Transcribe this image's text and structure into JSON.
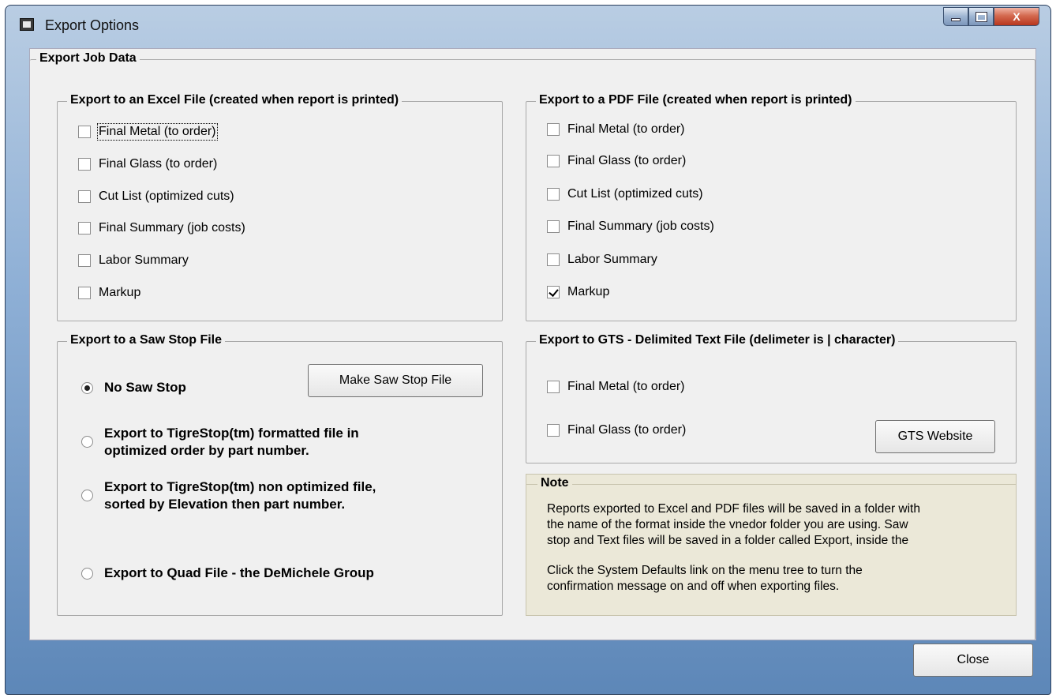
{
  "window": {
    "title": "Export Options",
    "controls": {
      "close_label": "X"
    }
  },
  "main_group": {
    "title": "Export Job Data"
  },
  "excel": {
    "title": "Export to an Excel File (created when report is printed)",
    "items": [
      {
        "label": "Final Metal (to order)",
        "checked": false
      },
      {
        "label": "Final Glass (to order)",
        "checked": false
      },
      {
        "label": "Cut List (optimized cuts)",
        "checked": false
      },
      {
        "label": "Final Summary (job costs)",
        "checked": false
      },
      {
        "label": "Labor Summary",
        "checked": false
      },
      {
        "label": "Markup",
        "checked": false
      }
    ]
  },
  "pdf": {
    "title": "Export to a PDF File (created when report is printed)",
    "items": [
      {
        "label": "Final Metal (to order)",
        "checked": false
      },
      {
        "label": "Final Glass (to order)",
        "checked": false
      },
      {
        "label": "Cut List (optimized cuts)",
        "checked": false
      },
      {
        "label": "Final Summary (job costs)",
        "checked": false
      },
      {
        "label": "Labor Summary",
        "checked": false
      },
      {
        "label": "Markup",
        "checked": true
      }
    ]
  },
  "sawstop": {
    "title": "Export to a Saw Stop File",
    "button_label": "Make Saw Stop File",
    "options": [
      {
        "line1": "No Saw Stop",
        "line2": "",
        "selected": true
      },
      {
        "line1": "Export to TigreStop(tm) formatted file in",
        "line2": "optimized order by part number.",
        "selected": false
      },
      {
        "line1": "Export to TigreStop(tm) non optimized file,",
        "line2": "sorted by Elevation then part number.",
        "selected": false
      },
      {
        "line1": "Export to Quad File - the DeMichele Group",
        "line2": "",
        "selected": false
      }
    ]
  },
  "gts": {
    "title": "Export to GTS - Delimited Text File (delimeter is | character)",
    "items": [
      {
        "label": "Final Metal (to order)",
        "checked": false
      },
      {
        "label": "Final Glass (to order)",
        "checked": false
      }
    ],
    "button_label": "GTS Website"
  },
  "note": {
    "title": "Note",
    "para1": [
      "Reports exported to Excel and PDF files will be saved in a folder with",
      "the name of the format inside the vnedor folder you are using. Saw",
      "stop and Text files will be saved in a folder called Export, inside the"
    ],
    "para2": [
      "Click the System Defaults link on the menu tree to turn the",
      "confirmation message on and off when exporting files."
    ]
  },
  "footer": {
    "close_label": "Close"
  }
}
